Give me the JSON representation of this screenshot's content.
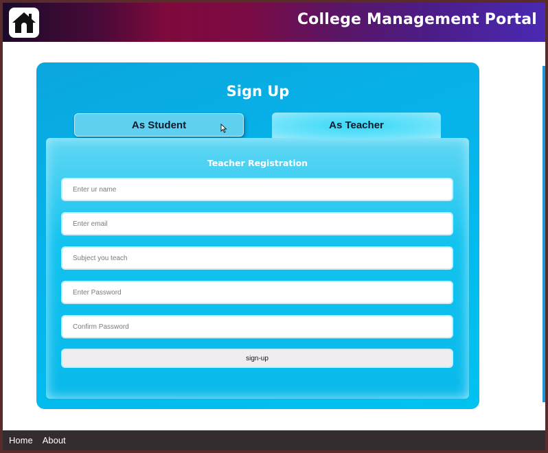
{
  "header": {
    "title": "College Management Portal",
    "logo_icon": "home-icon",
    "gradient_colors": [
      "#1b0a2a",
      "#7f0a3c",
      "#4a2ab3"
    ]
  },
  "signup": {
    "title": "Sign Up",
    "tabs": [
      {
        "label": "As Student",
        "active": false
      },
      {
        "label": "As Teacher",
        "active": true
      }
    ],
    "form": {
      "title": "Teacher Registration",
      "fields": [
        {
          "name": "name",
          "placeholder": "Enter ur name",
          "value": ""
        },
        {
          "name": "email",
          "placeholder": "Enter email",
          "value": ""
        },
        {
          "name": "subject",
          "placeholder": "Subject you teach",
          "value": ""
        },
        {
          "name": "password",
          "placeholder": "Enter Password",
          "value": ""
        },
        {
          "name": "confirm_password",
          "placeholder": "Confirm Password",
          "value": ""
        }
      ],
      "submit_label": "sign-up"
    },
    "accent_color": "#06b3ea"
  },
  "footer": {
    "links": [
      "Home",
      "About"
    ]
  }
}
